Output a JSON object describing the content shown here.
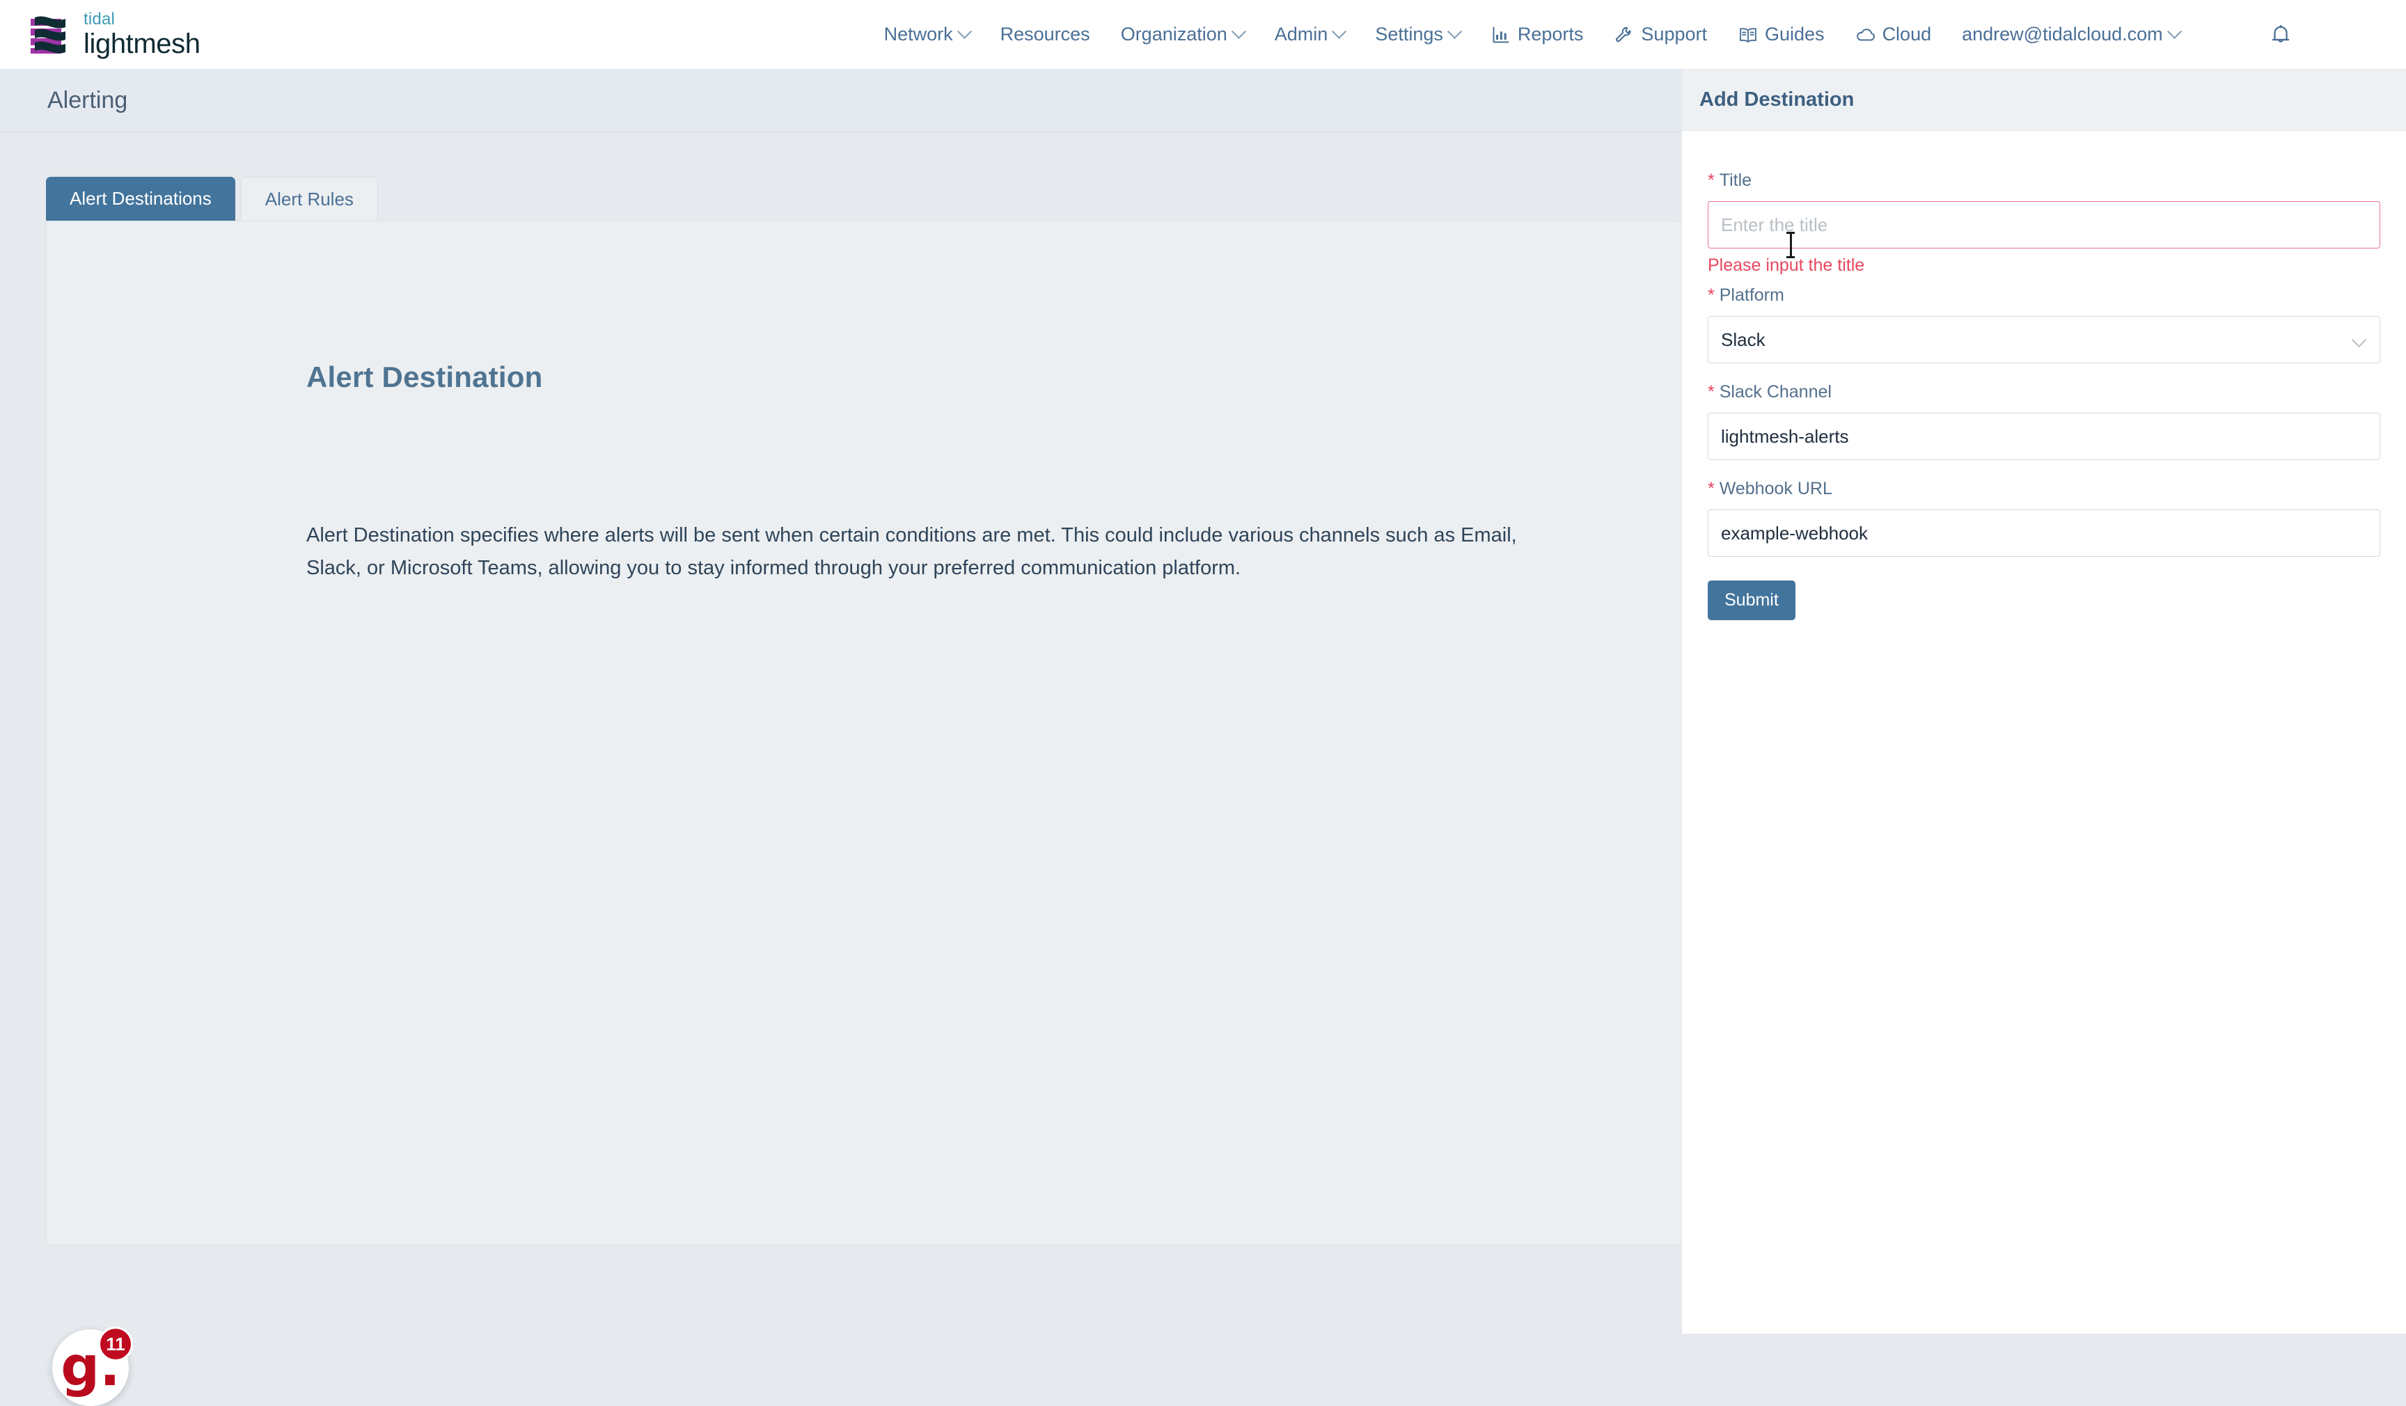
{
  "brand": {
    "top": "tidal",
    "bottom": "lightmesh"
  },
  "nav": {
    "center": [
      {
        "label": "Network",
        "has_caret": true
      },
      {
        "label": "Resources",
        "has_caret": false
      },
      {
        "label": "Organization",
        "has_caret": true
      },
      {
        "label": "Admin",
        "has_caret": true
      },
      {
        "label": "Settings",
        "has_caret": true
      }
    ],
    "right": [
      {
        "label": "Reports",
        "icon": "bar-chart-icon"
      },
      {
        "label": "Support",
        "icon": "wrench-icon"
      },
      {
        "label": "Guides",
        "icon": "book-icon"
      },
      {
        "label": "Cloud",
        "icon": "cloud-icon"
      },
      {
        "label": "andrew@tidalcloud.com",
        "icon": "",
        "has_caret": true
      }
    ],
    "bell_icon": "bell-icon"
  },
  "page": {
    "title": "Alerting"
  },
  "tabs": [
    {
      "label": "Alert Destinations",
      "active": true
    },
    {
      "label": "Alert Rules",
      "active": false
    }
  ],
  "content": {
    "heading": "Alert Destination",
    "paragraph": "Alert Destination specifies where alerts will be sent when certain conditions are met. This could include various channels such as Email, Slack, or Microsoft Teams, allowing you to stay informed through your preferred communication platform."
  },
  "side_panel": {
    "title": "Add Destination",
    "fields": {
      "title": {
        "label": "Title",
        "required_mark": "*",
        "value": "",
        "placeholder": "Enter the title",
        "error": "Please input the title"
      },
      "platform": {
        "label": "Platform",
        "required_mark": "*",
        "value": "Slack"
      },
      "slack_channel": {
        "label": "Slack Channel",
        "required_mark": "*",
        "value": "lightmesh-alerts"
      },
      "webhook_url": {
        "label": "Webhook URL",
        "required_mark": "*",
        "value": "example-webhook"
      }
    },
    "submit_label": "Submit"
  },
  "help_widget": {
    "logo": "g.",
    "badge": "11"
  },
  "colors": {
    "accent_blue": "#42749c",
    "error_red": "#e8485f",
    "brand_teal": "#3e9bb3",
    "brand_purple": "#a033a8",
    "help_red": "#c00a1f"
  }
}
